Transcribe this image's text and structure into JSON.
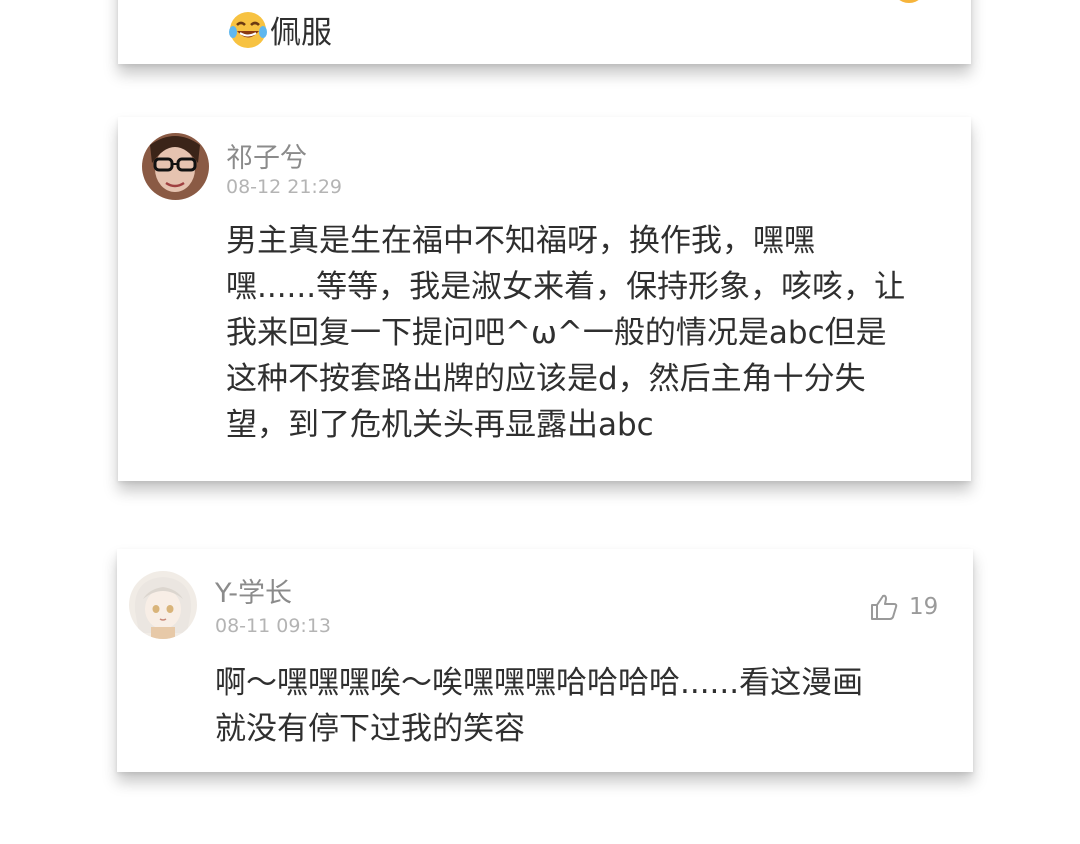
{
  "comments": [
    {
      "emoji": "laughing-tears-emoji",
      "text_line": "佩服"
    },
    {
      "username": "祁子兮",
      "timestamp": "08-12 21:29",
      "lines": [
        "男主真是生在福中不知福呀，换作我，嘿嘿",
        "嘿......等等，我是淑女来着，保持形象，咳咳，让",
        "我来回复一下提问吧^ω^一般的情况是abc但是",
        "这种不按套路出牌的应该是d，然后主角十分失",
        "望，到了危机关头再显露出abc"
      ]
    },
    {
      "username": "Y-学长",
      "timestamp": "08-11 09:13",
      "likes": "19",
      "like_icon": "thumbs-up-icon",
      "lines": [
        "啊～嘿嘿嘿唉～唉嘿嘿嘿哈哈哈哈......看这漫画",
        "就没有停下过我的笑容"
      ]
    }
  ]
}
